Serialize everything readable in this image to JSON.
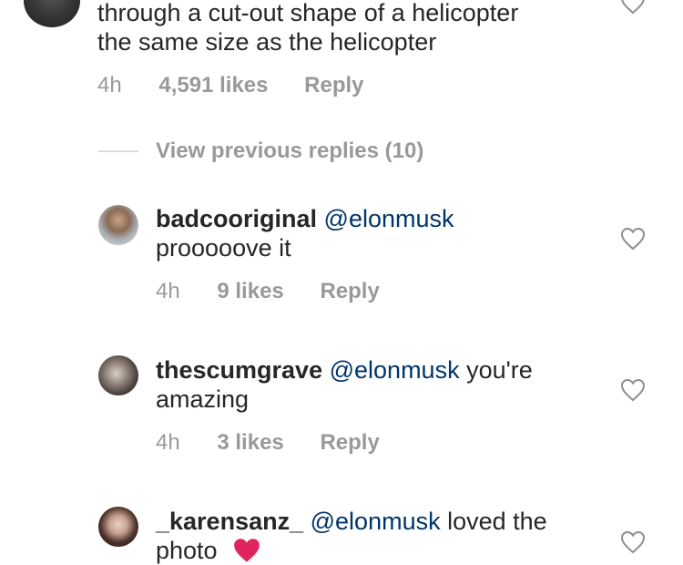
{
  "parent_comment": {
    "text_line1": "through a cut-out shape of a helicopter",
    "text_line2": "the same size as the helicopter",
    "time": "4h",
    "likes": "4,591 likes",
    "reply": "Reply"
  },
  "view_previous": {
    "label": "View previous replies (10)"
  },
  "replies": [
    {
      "username": "badcooriginal",
      "mention": "@elonmusk",
      "text_after_mention": "",
      "text_line2": "prooooove it",
      "time": "4h",
      "likes": "9 likes",
      "reply": "Reply"
    },
    {
      "username": "thescumgrave",
      "mention": "@elonmusk",
      "text_after_mention": " you're",
      "text_line2": "amazing",
      "time": "4h",
      "likes": "3 likes",
      "reply": "Reply"
    },
    {
      "username": "_karensanz_",
      "mention": "@elonmusk",
      "text_after_mention": " loved the",
      "text_line2": "photo",
      "emoji": "❤️"
    }
  ],
  "colors": {
    "text": "#262626",
    "meta": "#999999",
    "mention": "#003569",
    "heart_outline": "#8e8e8e",
    "emoji_heart": "#e0245e"
  }
}
